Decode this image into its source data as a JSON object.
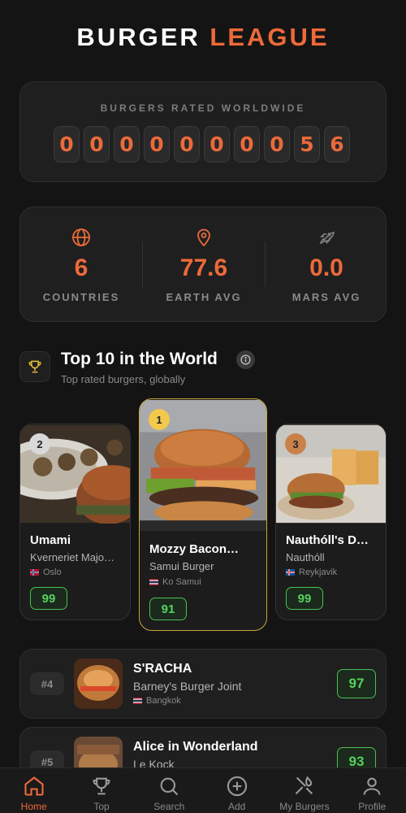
{
  "app": {
    "title_part1": "BURGER",
    "title_part2": "LEAGUE"
  },
  "counter": {
    "label": "BURGERS RATED WORLDWIDE",
    "digits": [
      "0",
      "0",
      "0",
      "0",
      "0",
      "0",
      "0",
      "0",
      "5",
      "6"
    ]
  },
  "stats": [
    {
      "value": "6",
      "label": "COUNTRIES",
      "icon": "globe-icon"
    },
    {
      "value": "77.6",
      "label": "EARTH AVG",
      "icon": "location-pin-icon"
    },
    {
      "value": "0.0",
      "label": "MARS AVG",
      "icon": "rocket-icon"
    }
  ],
  "section": {
    "title": "Top 10 in the World",
    "subtitle": "Top rated burgers, globally"
  },
  "podium": [
    {
      "rank": "2",
      "name": "Umami",
      "place": "Kverneriet Majo…",
      "city": "Oslo",
      "score": "99"
    },
    {
      "rank": "1",
      "name": "Mozzy Bacon…",
      "place": "Samui Burger",
      "city": "Ko Samui",
      "score": "91"
    },
    {
      "rank": "3",
      "name": "Nauthóll's D…",
      "place": "Nauthóll",
      "city": "Reykjavik",
      "score": "99"
    }
  ],
  "list": [
    {
      "rank": "#4",
      "name": "S'RACHA",
      "place": "Barney's Burger Joint",
      "city": "Bangkok",
      "score": "97"
    },
    {
      "rank": "#5",
      "name": "Alice in Wonderland",
      "place": "Le Kock",
      "city": "",
      "score": "93"
    }
  ],
  "tabs": [
    {
      "label": "Home",
      "icon": "home-icon"
    },
    {
      "label": "Top",
      "icon": "trophy-icon"
    },
    {
      "label": "Search",
      "icon": "search-icon"
    },
    {
      "label": "Add",
      "icon": "add-circle-icon"
    },
    {
      "label": "My Burgers",
      "icon": "utensils-icon"
    },
    {
      "label": "Profile",
      "icon": "person-icon"
    }
  ],
  "colors": {
    "accent": "#ec6a3a",
    "score_green": "#56d15f",
    "gold": "#c9a73a",
    "background": "#141414"
  }
}
